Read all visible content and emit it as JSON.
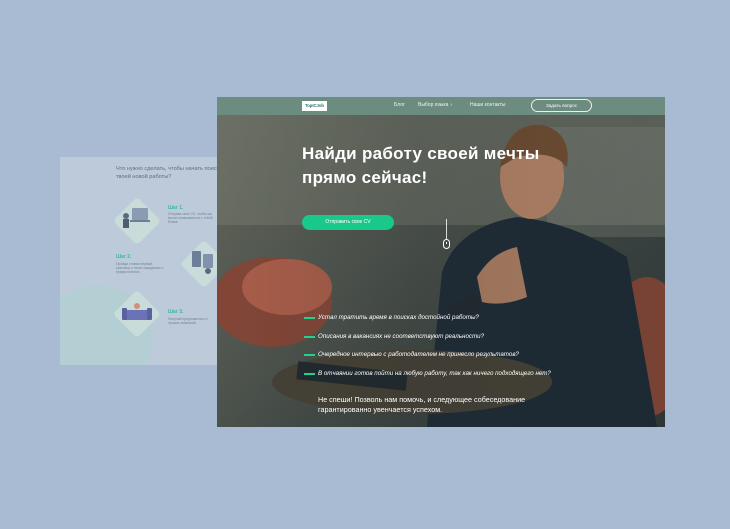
{
  "background_page": {
    "title": "Что нужно сделать, чтобы начать поиск твоей новой работы?",
    "steps": [
      {
        "label": "Шаг 1.",
        "text": "Отправь свое CV, чтобы мы могли ознакомиться с тобой ближе"
      },
      {
        "label": "Шаг 2.",
        "text": "Пройди с нами первый разговор о твоих ожиданиях и предпочтениях"
      },
      {
        "label": "Шаг 3.",
        "text": "Получай предложения от лучших компаний"
      }
    ]
  },
  "nav": {
    "logo": "TopICJob",
    "links": [
      "Блог",
      "Выбор языка",
      "Наши контакты"
    ],
    "cta": "Задать вопрос"
  },
  "hero": {
    "title": "Найди работу своей мечты прямо сейчас!",
    "button": "Отправить свое CV",
    "questions": [
      "Устал тратить время в поисках достойной работы?",
      "Описания в вакансиях не соответствуют реальности?",
      "Очередное интервью с работодателем не принесло результатов?",
      "В отчаянии готов пойти на любую работу, так как ничего подходящего нет?"
    ],
    "final": "Не спеши! Позволь нам помочь, и следующее собеседование гарантированно увенчается успехом."
  },
  "colors": {
    "page_bg": "#a9bbd2",
    "accent": "#18c98b",
    "nav_bg": "#6c8c80"
  }
}
